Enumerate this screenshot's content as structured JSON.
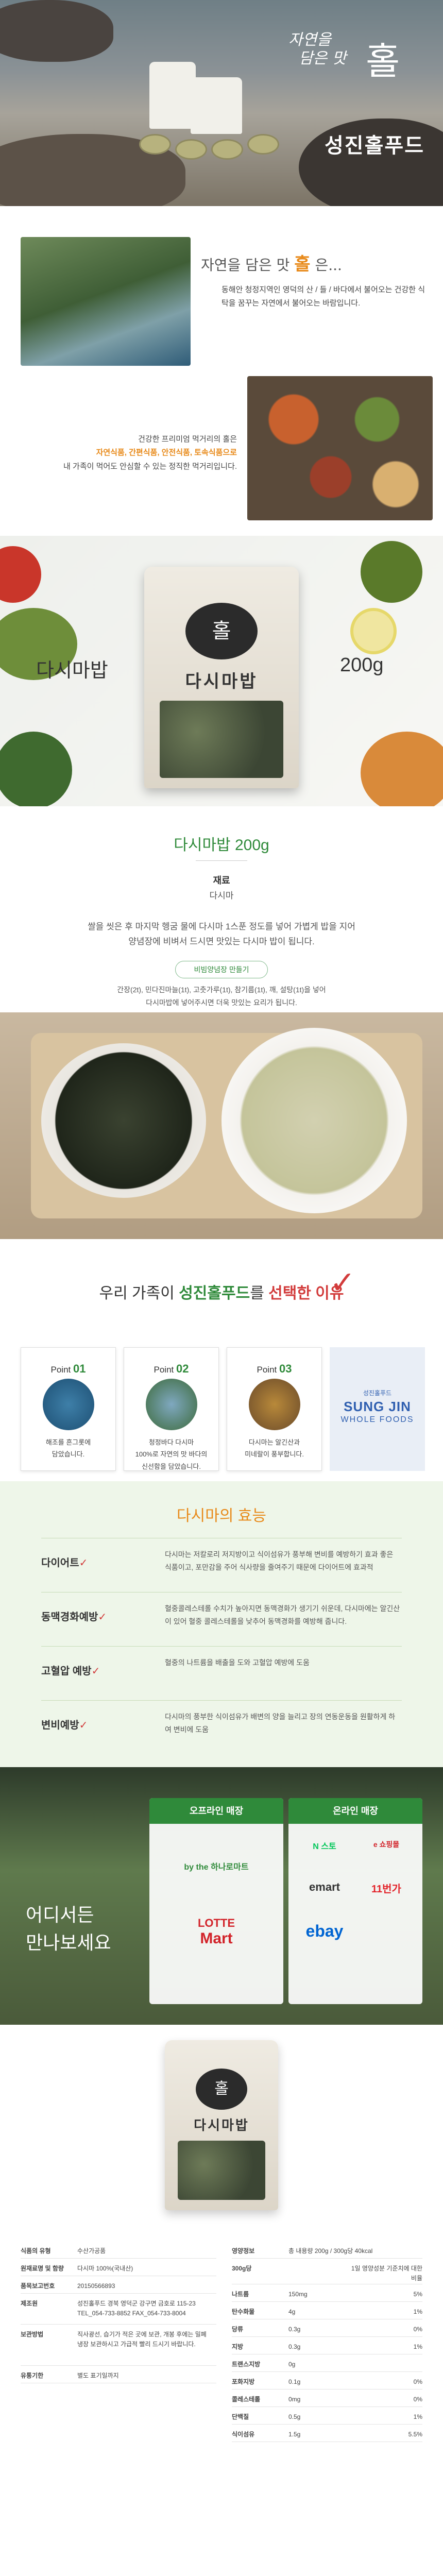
{
  "hero": {
    "script_line1": "자연을",
    "script_line2": "담은 맛",
    "big_char": "홀",
    "brand_name": "성진홀푸드"
  },
  "intro": {
    "heading_prefix": "자연을 담은 맛",
    "heading_big": "홀",
    "heading_suffix": "은...",
    "paragraph1": "동해안 청정지역인 영덕의 산 / 들 / 바다에서 불어오는 건강한 식탁을 꿈꾸는 자연에서 불어오는 바람입니다.",
    "paragraph2_line1": "건강한 프리미엄 먹거리의 홀은",
    "paragraph2_line2": "자연식품, 간편식품, 안전식품, 토속식품으로",
    "paragraph2_line3": "내 가족이 먹어도 안심할 수 있는 정직한 먹거리입니다."
  },
  "banner": {
    "left_label": "다시마밥",
    "right_label": "200g",
    "bag_seal": "홀",
    "bag_title": "다시마밥"
  },
  "product": {
    "title": "다시마밥 200g",
    "ingredient_label": "재료",
    "ingredient_value": "다시마",
    "directions_line1": "쌀을 씻은 후 마지막 헹굼 물에 다시마 1스푼 정도를 넣어 가볍게 밥을 지어",
    "directions_line2": "양념장에 비벼서 드시면 맛있는 다시마 밥이 됩니다.",
    "sauce_pill": "비빔양념장 만들기",
    "sauce_line1": "간장(2t), 민다진마늘(1t), 고춧가루(1t), 참기름(1t), 깨, 설탕(1t)을 넣어",
    "sauce_line2": "다시마밥에 넣어주시면 더욱 맛있는 요리가 됩니다."
  },
  "reasons": {
    "heading_prefix": "우리 가족이 ",
    "heading_brand": "성진홀푸드",
    "heading_mid": "를 ",
    "heading_em": "선택한 이유",
    "check": "✓",
    "points": [
      {
        "label": "Point",
        "num": "01",
        "line1": "해조를 흔그롯에",
        "line2": "담았습니다."
      },
      {
        "label": "Point",
        "num": "02",
        "line1": "청정바다 다시마",
        "line2": "100%로 자연의 맛 바다의",
        "line3": "신선함을 담았습니다."
      },
      {
        "label": "Point",
        "num": "03",
        "line1": "다시마는 알긴산과",
        "line2": "미네랄이 풍부합니다."
      }
    ],
    "brand_kor": "성진홀푸드",
    "brand_en1": "SUNG JIN",
    "brand_en2": "WHOLE FOODS"
  },
  "effects": {
    "heading": "다시마의 효능",
    "rows": [
      {
        "key": "다이어트",
        "text": "다시마는 저칼로리 저지방이고 식이섬유가 풍부해 변비를 예방하기 효과 좋은 식품이고, 포만감을 주어 식사량을 줄여주기 때문에 다이어트에 효과적"
      },
      {
        "key": "동맥경화예방",
        "text": "혈중콜레스테롤 수치가 높아지면 동맥경화가 생기기 쉬운데, 다시마에는 알긴산이 있어 혈중 콜레스테롤을 낮추어 동맥경화를 예방해 줍니다."
      },
      {
        "key": "고혈압 예방",
        "text": "혈중의 나트륨을 배출을 도와 고혈압 예방에 도움"
      },
      {
        "key": "변비예방",
        "text": "다시마의 풍부한 식이섬유가 배변의 양을 늘리고 장의 연동운동을 원활하게 하여 변비에 도움"
      }
    ]
  },
  "stores": {
    "left_line1": "어디서든",
    "left_line2": "만나보세요",
    "offline_header": "오프라인 매장",
    "offline_items": [
      "by the 하나로마트",
      "LOTTE",
      "Mart"
    ],
    "online_header": "온라인 매장",
    "online_items": [
      "N 스토",
      "e 쇼핑몰",
      "emart",
      "11번가",
      "ebay"
    ]
  },
  "bottom_bag": {
    "seal": "홀",
    "title": "다시마밥"
  },
  "info": {
    "left": [
      {
        "k": "식품의 유형",
        "v": "수산가공품"
      },
      {
        "k": "원재료명 및 함량",
        "v": "다시마 100%(국내산)"
      },
      {
        "k": "품목보고번호",
        "v": "20150566893"
      },
      {
        "k": "제조원",
        "v": "성진홀푸드 경북 영덕군 강구면 금호로 115-23",
        "v2": "TEL_054-733-8852  FAX_054-733-8004"
      },
      {
        "k": "보관방법",
        "v": "직사광선, 습기가 적은 곳에 보관, 개봉 후에는 밀폐",
        "v2": "냉장 보관하시고 가급적 빨리 드시기 바랍니다."
      },
      {
        "k": "유통기한",
        "v": "별도 표기일까지"
      }
    ],
    "right_header_k": "영양정보",
    "right_header_v": "총 내용량 200g / 300g당 40kcal",
    "right_sub1": "300g당",
    "right_sub2": "1일 영양성분 기준치에 대한 비율",
    "nutrients": [
      {
        "k": "나트륨",
        "v": "150mg",
        "p": "5%"
      },
      {
        "k": "탄수화물",
        "v": "4g",
        "p": "1%"
      },
      {
        "k": "당류",
        "v": "0.3g",
        "p": "0%"
      },
      {
        "k": "지방",
        "v": "0.3g",
        "p": "1%"
      },
      {
        "k": "트랜스지방",
        "v": "0g",
        "p": ""
      },
      {
        "k": "포화지방",
        "v": "0.1g",
        "p": "0%"
      },
      {
        "k": "콜레스테롤",
        "v": "0mg",
        "p": "0%"
      },
      {
        "k": "단백질",
        "v": "0.5g",
        "p": "1%"
      },
      {
        "k": "식이섬유",
        "v": "1.5g",
        "p": "5.5%"
      }
    ]
  }
}
